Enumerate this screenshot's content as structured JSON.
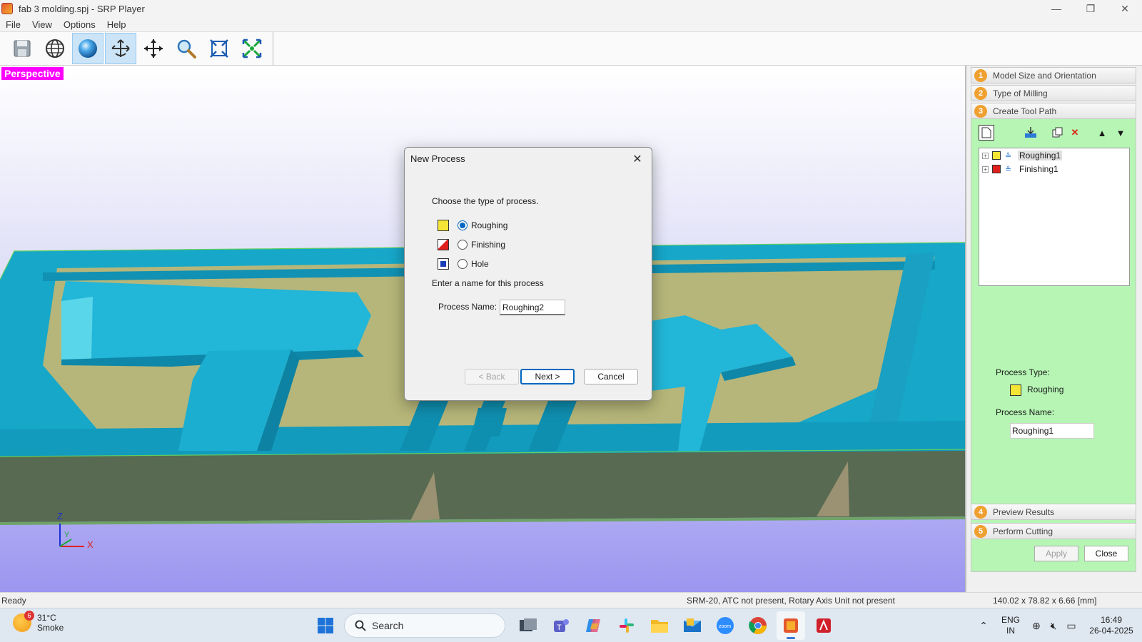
{
  "window": {
    "title": "fab 3 molding.spj - SRP Player",
    "controls": {
      "minimize": "—",
      "maximize": "❐",
      "close": "✕"
    }
  },
  "menu": [
    "File",
    "View",
    "Options",
    "Help"
  ],
  "toolbar": {
    "buttons": [
      "save-icon",
      "globe-wireframe-icon",
      "shaded-sphere-icon",
      "rotate-view-icon",
      "pan-icon",
      "zoom-icon",
      "fit-view-icon",
      "zoom-extents-icon"
    ]
  },
  "viewport": {
    "view_label": "Perspective",
    "axes": {
      "z": "Z",
      "y": "Y",
      "x": "X"
    }
  },
  "panel": {
    "steps": [
      {
        "num": "1",
        "label": "Model Size and Orientation"
      },
      {
        "num": "2",
        "label": "Type of Milling"
      },
      {
        "num": "3",
        "label": "Create Tool Path"
      },
      {
        "num": "4",
        "label": "Preview Results"
      },
      {
        "num": "5",
        "label": "Perform Cutting"
      }
    ],
    "tree": [
      {
        "label": "Roughing1",
        "expander": "+"
      },
      {
        "label": "Finishing1",
        "expander": "+"
      }
    ],
    "process_type_label": "Process Type:",
    "process_type_value": "Roughing",
    "process_name_label": "Process Name:",
    "process_name_value": "Roughing1",
    "apply_label": "Apply",
    "close_label": "Close",
    "tool_buttons": {
      "delete": "✕",
      "up": "▲",
      "down": "▼"
    }
  },
  "dialog": {
    "title": "New Process",
    "close_glyph": "✕",
    "prompt": "Choose the type of process.",
    "options": [
      {
        "label": "Roughing",
        "checked": true,
        "color": "#f5e636"
      },
      {
        "label": "Finishing",
        "checked": false,
        "color": "#e0201c"
      },
      {
        "label": "Hole",
        "checked": false,
        "color": "#1a3db8"
      }
    ],
    "name_prompt": "Enter a name for this process",
    "name_label": "Process Name:",
    "name_value": "Roughing2",
    "back_label": "< Back",
    "next_label": "Next >",
    "cancel_label": "Cancel"
  },
  "status": {
    "left": "Ready",
    "machine": "SRM-20, ATC not present, Rotary Axis Unit not present",
    "dimensions": "140.02 x  78.82 x  6.66 [mm]"
  },
  "taskbar": {
    "weather": {
      "temp": "31°C",
      "condition": "Smoke",
      "badge": "6"
    },
    "search_label": "Search",
    "lang_line1": "ENG",
    "lang_line2": "IN",
    "time": "16:49",
    "date": "26-04-2025"
  },
  "colors": {
    "accent": "#0067c0",
    "perspective_tag": "#ff00ff",
    "panel_green": "#b6f5b4",
    "model_cyan": "#18a6c8",
    "model_floor": "#b8b870"
  }
}
